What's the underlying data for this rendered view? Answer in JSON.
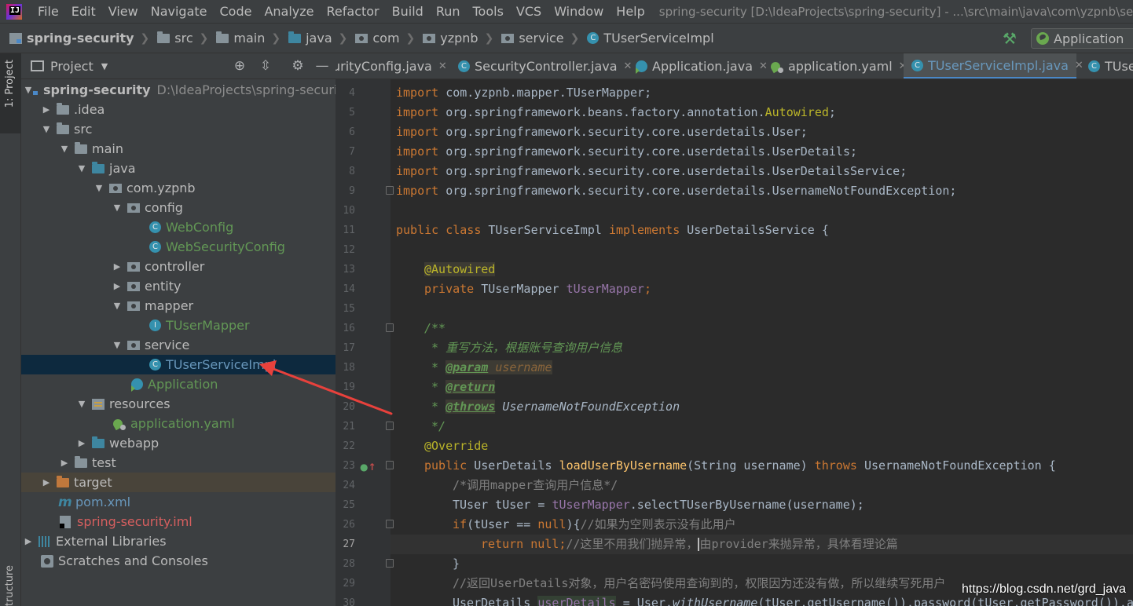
{
  "menubar": {
    "items": [
      "File",
      "Edit",
      "View",
      "Navigate",
      "Code",
      "Analyze",
      "Refactor",
      "Build",
      "Run",
      "Tools",
      "VCS",
      "Window",
      "Help"
    ],
    "window_title": "spring-security [D:\\IdeaProjects\\spring-security] - ...\\src\\main\\java\\com\\yzpnb\\service\\TUs"
  },
  "navbar": {
    "crumbs": [
      "spring-security",
      "src",
      "main",
      "java",
      "com",
      "yzpnb",
      "service",
      "TUserServiceImpl"
    ],
    "run_config": "Application"
  },
  "stripe": {
    "project_label": "1: Project",
    "structure_label": "tructure"
  },
  "project_panel": {
    "title": "Project",
    "tree": [
      {
        "label": "spring-security",
        "path": "D:\\IdeaProjects\\spring-security"
      },
      {
        "label": ".idea"
      },
      {
        "label": "src"
      },
      {
        "label": "main"
      },
      {
        "label": "java"
      },
      {
        "label": "com.yzpnb"
      },
      {
        "label": "config"
      },
      {
        "label": "WebConfig"
      },
      {
        "label": "WebSecurityConfig"
      },
      {
        "label": "controller"
      },
      {
        "label": "entity"
      },
      {
        "label": "mapper"
      },
      {
        "label": "TUserMapper"
      },
      {
        "label": "service"
      },
      {
        "label": "TUserServiceImpl"
      },
      {
        "label": "Application"
      },
      {
        "label": "resources"
      },
      {
        "label": "application.yaml"
      },
      {
        "label": "webapp"
      },
      {
        "label": "test"
      },
      {
        "label": "target"
      },
      {
        "label": "pom.xml"
      },
      {
        "label": "spring-security.iml"
      },
      {
        "label": "External Libraries"
      },
      {
        "label": "Scratches and Consoles"
      }
    ]
  },
  "tabs": [
    {
      "label": "urityConfig.java"
    },
    {
      "label": "SecurityController.java"
    },
    {
      "label": "Application.java"
    },
    {
      "label": "application.yaml"
    },
    {
      "label": "TUserServiceImpl.java"
    },
    {
      "label": "TUse"
    }
  ],
  "editor": {
    "line_numbers": [
      "4",
      "5",
      "6",
      "7",
      "8",
      "9",
      "10",
      "11",
      "12",
      "13",
      "14",
      "15",
      "16",
      "17",
      "18",
      "19",
      "20",
      "21",
      "22",
      "23",
      "24",
      "25",
      "26",
      "27",
      "28",
      "29",
      "30"
    ],
    "current_line": "27",
    "line4_pkg": "com.yzpnb.mapper.TUserMapper;",
    "line5_pkg": "org.springframework.beans.factory.annotation.",
    "line5_ann": "Autowired",
    "line6_pkg": "org.springframework.security.core.userdetails.User;",
    "line7_pkg": "org.springframework.security.core.userdetails.UserDetails;",
    "line8_pkg": "org.springframework.security.core.userdetails.UserDetailsService;",
    "line9_pkg": "org.springframework.security.core.userdetails.UsernameNotFoundException;",
    "kw_import": "import",
    "kw_public": "public",
    "kw_class": "class",
    "kw_implements": "implements",
    "kw_private": "private",
    "kw_throws": "throws",
    "kw_if": "if",
    "kw_null": "null",
    "kw_return": "return",
    "class_name": "TUserServiceImpl",
    "iface_name": "UserDetailsService {",
    "annot_autowired": "@Autowired",
    "field_type": "TUserMapper",
    "field_name": "tUserMapper",
    "semi": ";",
    "doc_open": "/**",
    "doc_desc": " * 重写方法，根据账号查询用户信息",
    "doc_star": " * ",
    "doc_param_tag": "@param",
    "doc_param_val": "username",
    "doc_return_tag": "@return",
    "doc_throws_tag": "@throws",
    "doc_throws_val": " UsernameNotFoundException",
    "doc_close": " */",
    "annot_override": "@Override",
    "ret_type": "UserDetails",
    "method_name": "loadUserByUsername",
    "params": "(String username)",
    "exception": "UsernameNotFoundException {",
    "l24_comment": "/*调用mapper查询用户信息*/",
    "l25_a": "TUser tUser = ",
    "l25_b": ".selectTUserByUsername(username);",
    "l26_a": "(tUser == ",
    "l26_b": "){",
    "l26_comment": "//如果为空则表示没有此用户",
    "l27_comment_a": "//这里不用我们抛异常，",
    "l27_comment_b": "由provider来抛异常，具体看理论篇",
    "l28": "}",
    "l29_comment": "//返回UserDetails对象，用户名密码使用查询到的，权限因为还没有做，所以继续写死用户",
    "l30_a": "UserDetails ",
    "l30_var": "userDetails",
    "l30_b": " = User.",
    "l30_static": "withUsername",
    "l30_c": "(tUser.getUsername()).password(tUser.getPassword()).au"
  },
  "watermark": "https://blog.csdn.net/grd_java",
  "colors": {
    "selection": "#0d293e",
    "accent": "#4a88c7",
    "arrow": "#e8413c"
  }
}
